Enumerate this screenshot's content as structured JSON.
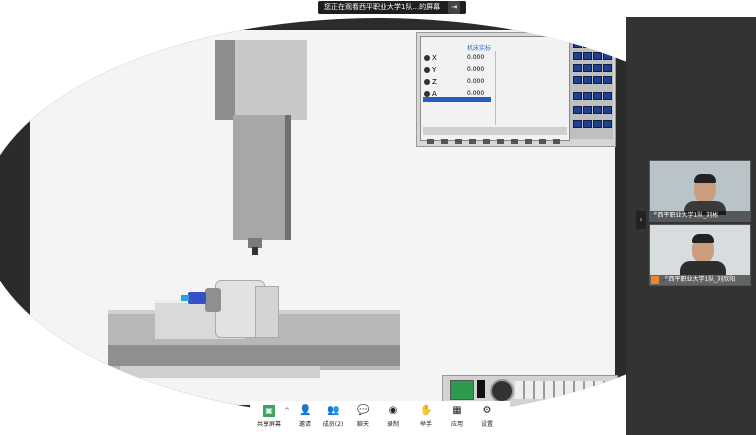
{
  "banner": {
    "text": "您正在观看西平职业大学1队...的屏幕",
    "stop_icon": "exit-icon"
  },
  "cnc": {
    "title": "机床实标",
    "axes": [
      {
        "name": "X",
        "value": "0.000"
      },
      {
        "name": "Y",
        "value": "0.000"
      },
      {
        "name": "Z",
        "value": "0.000"
      },
      {
        "name": "A",
        "value": "0.000"
      }
    ]
  },
  "participants": [
    {
      "label": "西平职业大学1队_刘彬"
    },
    {
      "label": "西平职业大学1队_刘欣阳"
    }
  ],
  "toolbar": {
    "items": [
      {
        "label": "共享屏幕",
        "icon": "share-screen-icon"
      },
      {
        "label": "邀请",
        "icon": "invite-icon"
      },
      {
        "label": "成员(2)",
        "icon": "members-icon"
      },
      {
        "label": "聊天",
        "icon": "chat-icon"
      },
      {
        "label": "录制",
        "icon": "record-icon"
      },
      {
        "label": "举手",
        "icon": "raise-hand-icon"
      },
      {
        "label": "应用",
        "icon": "apps-icon"
      },
      {
        "label": "设置",
        "icon": "settings-icon"
      }
    ]
  },
  "colors": {
    "accent": "#2b5cc0",
    "panel": "#d6d6d6",
    "machine_grey": "#9e9e9e"
  }
}
